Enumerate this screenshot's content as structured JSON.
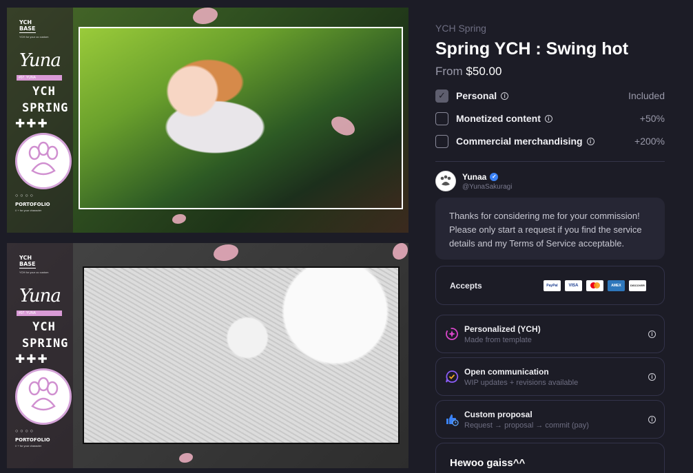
{
  "gallery": {
    "artworks": [
      {
        "type": "color",
        "side": {
          "base_label": "YCH\nBASE",
          "caption": "YCH for your oc custom",
          "signature": "Yuna",
          "tag": "#07. YUNA",
          "title": "YCH SPRING",
          "plus_marks": "✚✚✚",
          "dots": "○○○○",
          "portfolio": "PORTOFOLIO",
          "portfolio_sub": "// + for your character"
        }
      },
      {
        "type": "sketch",
        "side": {
          "base_label": "YCH\nBASE",
          "caption": "YCH for your oc custom",
          "signature": "Yuna",
          "tag": "#07. YUNA",
          "title": "YCH SPRING",
          "plus_marks": "✚✚✚",
          "dots": "○○○○",
          "portfolio": "PORTOFOLIO",
          "portfolio_sub": "// + for your character"
        }
      }
    ]
  },
  "listing": {
    "category": "YCH Spring",
    "title": "Spring YCH : Swing hot",
    "price_prefix": "From",
    "price": "$50.00"
  },
  "options": [
    {
      "label": "Personal",
      "price": "Included",
      "checked": true
    },
    {
      "label": "Monetized content",
      "price": "+50%",
      "checked": false
    },
    {
      "label": "Commercial merchandising",
      "price": "+200%",
      "checked": false
    }
  ],
  "seller": {
    "name": "Yunaa",
    "handle": "@YunaSakuragi",
    "verified": true
  },
  "message": "Thanks for considering me for your commission! Please only start a request if you find the service details and my Terms of Service acceptable.",
  "accepts": {
    "label": "Accepts",
    "methods": [
      "PayPal",
      "VISA",
      "Mastercard",
      "AMEX",
      "DISCOVER"
    ]
  },
  "features": [
    {
      "title": "Personalized (YCH)",
      "subtitle": "Made from template",
      "icon": "sparkle-swap-icon",
      "color": "#d946c9"
    },
    {
      "title": "Open communication",
      "subtitle": "WIP updates + revisions available",
      "icon": "chat-check-icon",
      "color": "#f5a623"
    },
    {
      "title": "Custom proposal",
      "subtitle": "Request → proposal → commit (pay)",
      "icon": "thumbs-up-clock-icon",
      "color": "#3b82f6"
    }
  ],
  "description": {
    "heading": "Hewoo gaiss^^"
  },
  "colors": {
    "background": "#1c1c26",
    "card_border": "#33334a",
    "verified_blue": "#3b82f6"
  }
}
